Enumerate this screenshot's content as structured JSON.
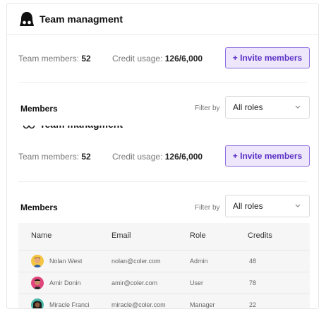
{
  "app": {
    "title": "Team managment"
  },
  "stats": {
    "members_label": "Team members:",
    "members_value": "52",
    "credit_label": "Credit usage:",
    "credit_value": "126/6,000"
  },
  "invite_button": {
    "label": "+ Invite members"
  },
  "members_section": {
    "title": "Members",
    "filter_label": "Filter by",
    "filter_value": "All roles"
  },
  "table": {
    "headers": {
      "name": "Name",
      "email": "Email",
      "role": "Role",
      "credits": "Credits"
    },
    "rows": [
      {
        "name": "Nolan West",
        "email": "nolan@coler.com",
        "role": "Admin",
        "credits": "48"
      },
      {
        "name": "Amir Donin",
        "email": "amir@coler.com",
        "role": "User",
        "credits": "78"
      },
      {
        "name": "Miracle Franci",
        "email": "miracle@coler.com",
        "role": "Manager",
        "credits": "22"
      }
    ]
  },
  "colors": {
    "accent": "#5b2fc4",
    "accent_bg": "#eee7fc",
    "accent_border": "#8c6ae0"
  },
  "icons": {
    "logo": "hair-glasses-avatar-icon",
    "dropdown": "chevron-down-icon"
  }
}
